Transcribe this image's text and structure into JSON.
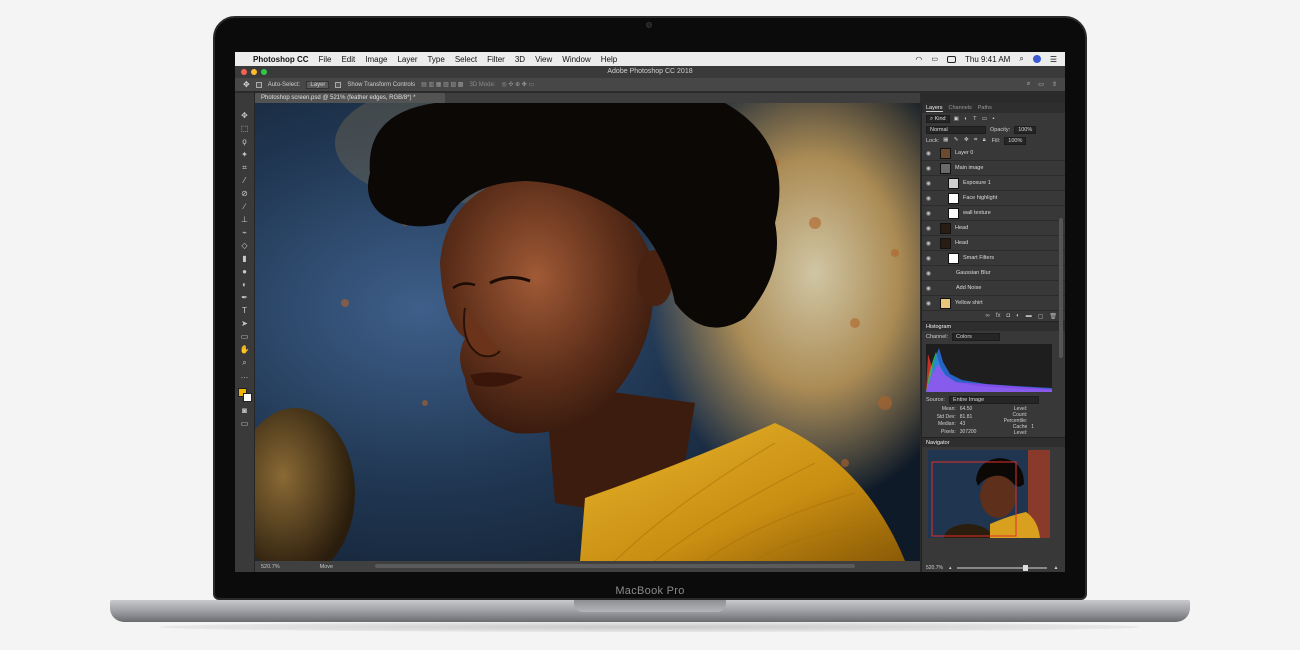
{
  "device": {
    "label": "MacBook Pro"
  },
  "menubar": {
    "apple": "",
    "app_name": "Photoshop CC",
    "items": [
      "File",
      "Edit",
      "Image",
      "Layer",
      "Type",
      "Select",
      "Filter",
      "3D",
      "View",
      "Window",
      "Help"
    ],
    "clock": "Thu 9:41 AM",
    "icons": [
      "wifi-icon",
      "airplay-icon",
      "battery-icon",
      "search-icon",
      "siri-icon",
      "list-icon"
    ]
  },
  "window": {
    "title": "Adobe Photoshop CC 2018",
    "lights": [
      "#fc5f57",
      "#fdbc2e",
      "#33c748"
    ]
  },
  "options": {
    "auto_select_label": "Auto-Select:",
    "auto_select_value": "Layer",
    "transform_label": "Show Transform Controls",
    "mode_3d": "3D Mode:"
  },
  "document": {
    "tab_label": "Photoshop screen.psd @ 521% (feather edges, RGB/8*) *"
  },
  "status": {
    "zoom": "520.7%",
    "tool": "Move"
  },
  "layers_panel": {
    "tabs": [
      "Layers",
      "Channels",
      "Paths"
    ],
    "kind_label": "Kind",
    "blend_mode": "Normal",
    "opacity_label": "Opacity:",
    "opacity_value": "100%",
    "lock_label": "Lock:",
    "fill_label": "Fill:",
    "fill_value": "100%",
    "layers": [
      {
        "name": "Layer 0",
        "thumb": "#6b4a2e",
        "indent": 0
      },
      {
        "name": "Main image",
        "thumb": "#6a6a6a",
        "indent": 0
      },
      {
        "name": "Exposure 1",
        "thumb": "#cfcfcf",
        "indent": 1
      },
      {
        "name": "Face highlight",
        "thumb": "#ffffff",
        "indent": 1
      },
      {
        "name": "wall texture",
        "thumb": "#ffffff",
        "indent": 1
      },
      {
        "name": "Head",
        "thumb": "#2a1c14",
        "indent": 0
      },
      {
        "name": "Head",
        "thumb": "#2a1c14",
        "indent": 0
      },
      {
        "name": "Smart Filters",
        "thumb": "#ffffff",
        "indent": 1
      },
      {
        "name": "Gaussian Blur",
        "thumb": "",
        "indent": 2
      },
      {
        "name": "Add Noise",
        "thumb": "",
        "indent": 2
      },
      {
        "name": "Yellow shirt",
        "thumb": "#e8c67a",
        "indent": 0
      }
    ],
    "footer_icons": [
      "link-icon",
      "fx-icon",
      "mask-icon",
      "adjustment-icon",
      "folder-icon",
      "new-layer-icon",
      "trash-icon"
    ]
  },
  "histogram": {
    "title": "Histogram",
    "channel_label": "Channel:",
    "channel_value": "Colors",
    "source_label": "Source:",
    "source_value": "Entire Image",
    "stats_left": [
      {
        "k": "Mean:",
        "v": "64.50"
      },
      {
        "k": "Std Dev:",
        "v": "81.81"
      },
      {
        "k": "Median:",
        "v": "43"
      },
      {
        "k": "Pixels:",
        "v": "307200"
      }
    ],
    "stats_right": [
      {
        "k": "Level:",
        "v": ""
      },
      {
        "k": "Count:",
        "v": ""
      },
      {
        "k": "Percentile:",
        "v": ""
      },
      {
        "k": "Cache Level:",
        "v": "1"
      }
    ]
  },
  "navigator": {
    "title": "Navigator",
    "zoom": "520.7%",
    "slider_value": 0.78
  }
}
